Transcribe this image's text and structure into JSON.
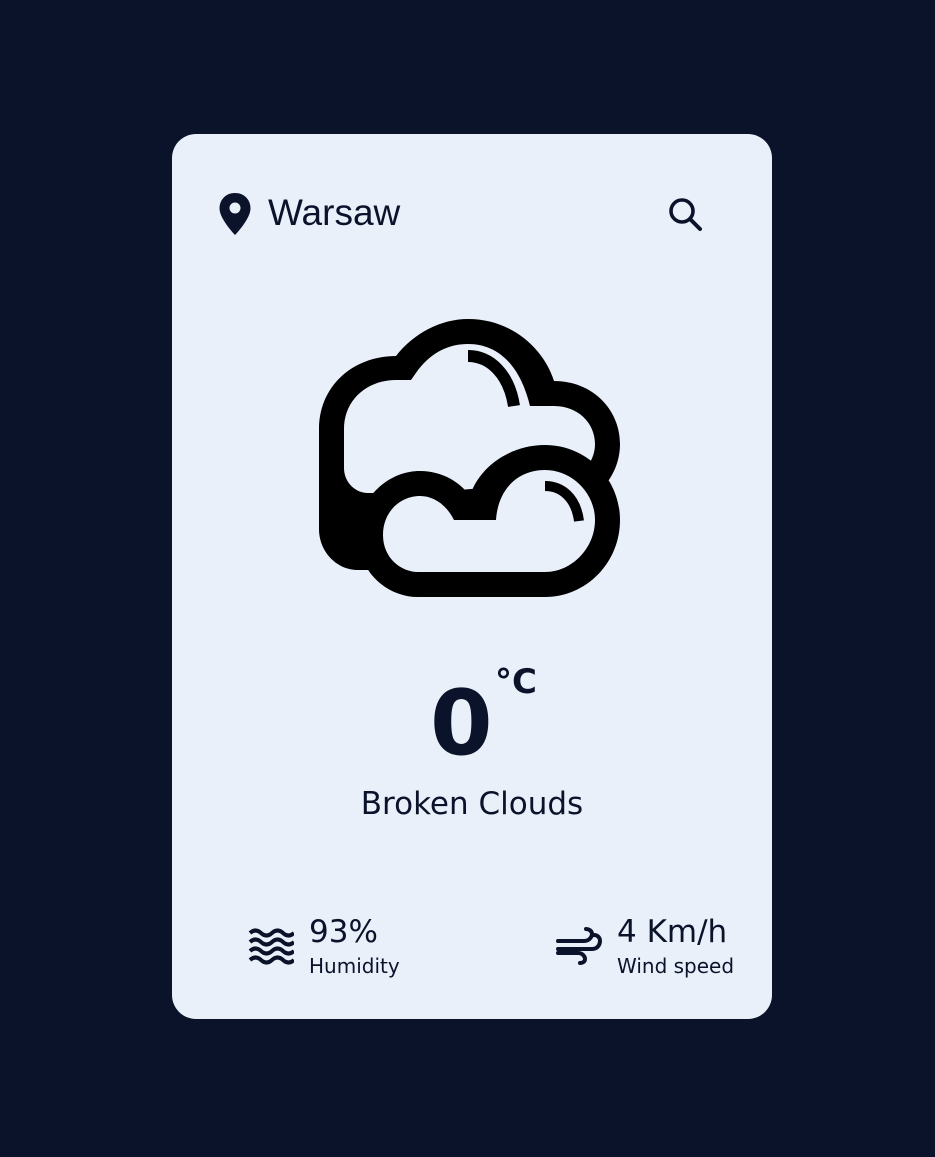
{
  "location": {
    "icon": "location-pin-icon",
    "city": "Warsaw"
  },
  "search": {
    "icon": "search-icon"
  },
  "weather": {
    "icon": "broken-clouds-icon",
    "temperature": "0",
    "unit": "°C",
    "description": "Broken Clouds"
  },
  "humidity": {
    "icon": "humidity-waves-icon",
    "value": "93%",
    "label": "Humidity"
  },
  "wind": {
    "icon": "wind-icon",
    "value": "4 Km/h",
    "label": "Wind speed"
  },
  "colors": {
    "background": "#0b132b",
    "card": "#eaf0fa",
    "text": "#0b132b"
  }
}
